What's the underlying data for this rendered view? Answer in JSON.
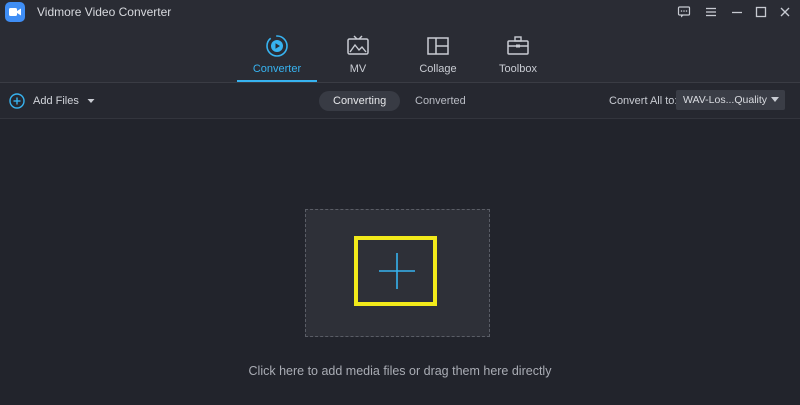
{
  "app": {
    "title": "Vidmore Video Converter",
    "accent_color": "#37b3f0",
    "highlight_color": "#f2ea1a"
  },
  "window_controls": [
    {
      "name": "feedback-icon"
    },
    {
      "name": "menu-icon"
    },
    {
      "name": "minimize-icon"
    },
    {
      "name": "maximize-icon"
    },
    {
      "name": "close-icon"
    }
  ],
  "nav": {
    "tabs": [
      {
        "label": "Converter",
        "icon": "converter-icon",
        "active": true
      },
      {
        "label": "MV",
        "icon": "mv-icon",
        "active": false
      },
      {
        "label": "Collage",
        "icon": "collage-icon",
        "active": false
      },
      {
        "label": "Toolbox",
        "icon": "toolbox-icon",
        "active": false
      }
    ]
  },
  "toolbar": {
    "add_files_label": "Add Files",
    "segments": [
      "Converting",
      "Converted"
    ],
    "active_segment": "Converting",
    "convert_all_label": "Convert All to:",
    "convert_all_value": "WAV-Los...Quality"
  },
  "main": {
    "hint": "Click here to add media files or drag them here directly"
  }
}
